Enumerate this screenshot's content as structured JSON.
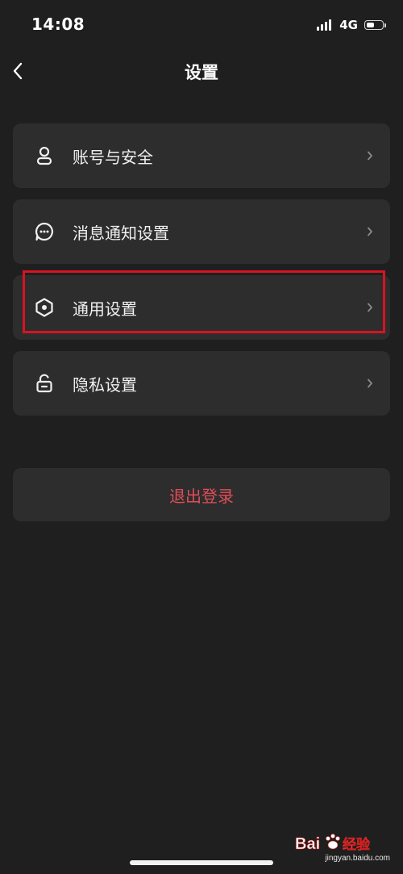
{
  "status_bar": {
    "time": "14:08",
    "network": "4G",
    "battery_level": 0.55
  },
  "header": {
    "title": "设置",
    "back_icon": "chevron-left-icon"
  },
  "settings": {
    "items": [
      {
        "label": "账号与安全",
        "icon": "user-icon",
        "highlighted": false
      },
      {
        "label": "消息通知设置",
        "icon": "message-icon",
        "highlighted": false
      },
      {
        "label": "通用设置",
        "icon": "hexagon-icon",
        "highlighted": true
      },
      {
        "label": "隐私设置",
        "icon": "lock-icon",
        "highlighted": false
      }
    ]
  },
  "logout": {
    "label": "退出登录"
  },
  "watermark": {
    "logo_text": "Bai 经验",
    "url": "jingyan.baidu.com"
  },
  "colors": {
    "background": "#1f1f1f",
    "card": "#2d2d2d",
    "logout_text": "#e14d57",
    "highlight_border": "#d81322"
  }
}
